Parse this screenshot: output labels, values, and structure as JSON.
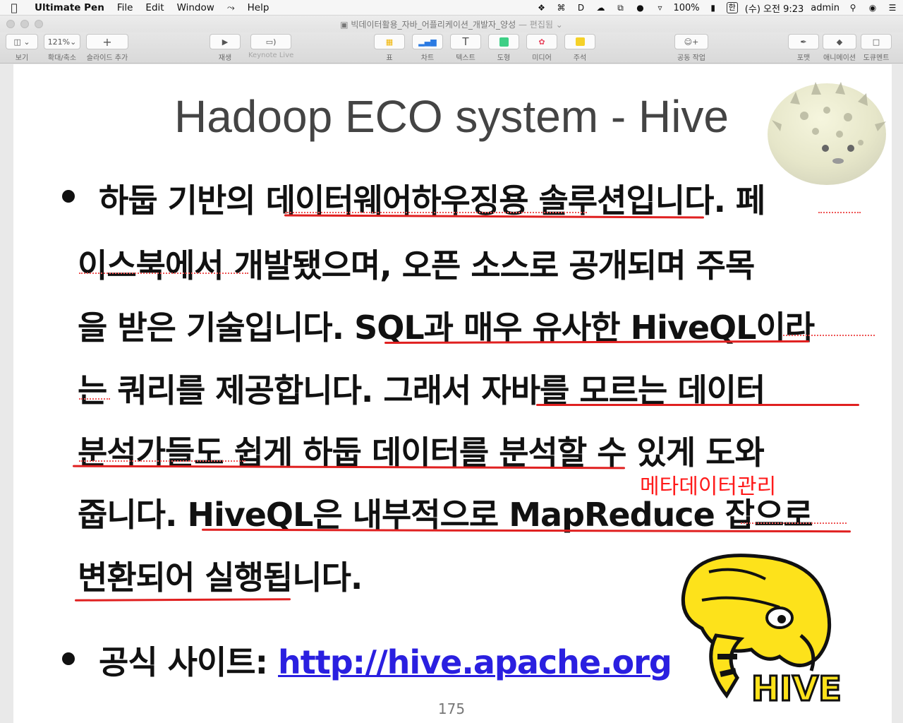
{
  "menubar": {
    "app_name": "Ultimate Pen",
    "menus": [
      "File",
      "Edit",
      "Window",
      "Help"
    ],
    "battery": "100%",
    "input_source": "한",
    "clock": "(수) 오전 9:23",
    "user": "admin"
  },
  "window": {
    "document_title": "빅데이터활용_자바_어플리케이션_개발자_양성",
    "edited_label": "— 편집됨"
  },
  "toolbar": {
    "view_label": "보기",
    "zoom_value": "121%",
    "zoom_label": "확대/축소",
    "add_slide_label": "슬라이드 추가",
    "play_label": "재생",
    "keynote_live_label": "Keynote Live",
    "table_label": "표",
    "chart_label": "차트",
    "text_label": "텍스트",
    "shape_label": "도형",
    "media_label": "미디어",
    "comment_label": "주석",
    "collaborate_label": "공동 작업",
    "format_label": "포맷",
    "animate_label": "애니메이션",
    "document_label": "도큐멘트"
  },
  "slide": {
    "title": "Hadoop ECO system - Hive",
    "lines": [
      "하둡 기반의 데이터웨어하우징용 솔루션입니다. 페",
      "이스북에서 개발됐으며, 오픈 소스로 공개되며 주목",
      "을 받은 기술입니다. SQL과 매우 유사한 HiveQL이라",
      "는 쿼리를 제공합니다. 그래서 자바를 모르는 데이터",
      "분석가들도 쉽게 하둡 데이터를 분석할 수 있게 도와",
      "줍니다. HiveQL은 내부적으로 MapReduce 잡으로",
      "변환되어 실행됩니다."
    ],
    "site_label": "공식 사이트: ",
    "site_url": "http://hive.apache.org",
    "annotation": "메타데이터관리",
    "page_number": "175",
    "logo_text": "HIVE"
  }
}
